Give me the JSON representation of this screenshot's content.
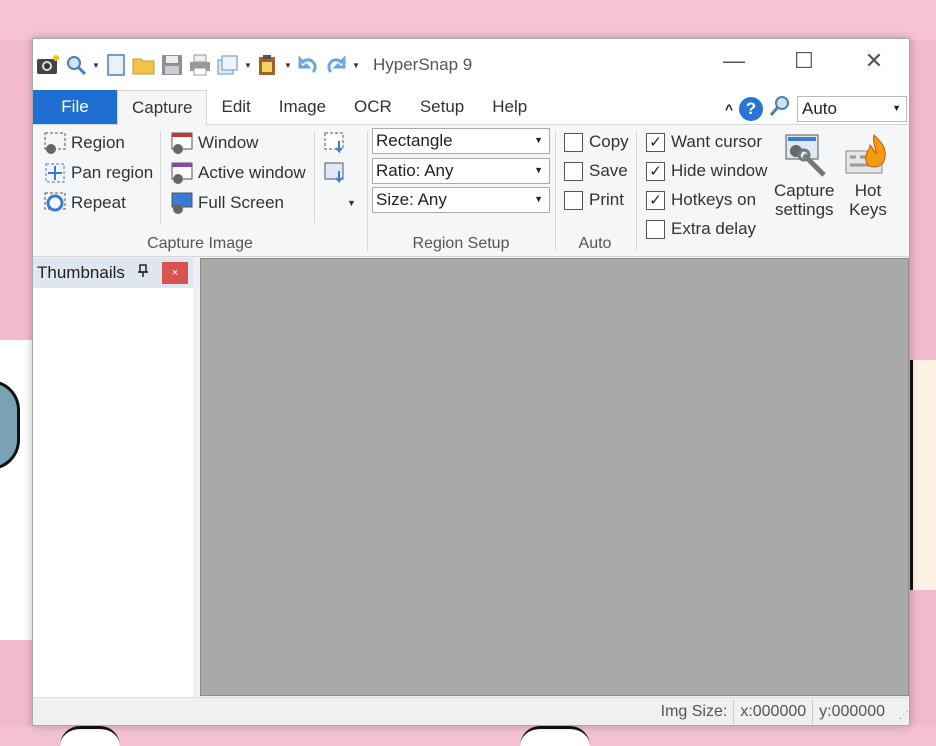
{
  "window": {
    "title": "HyperSnap 9"
  },
  "quick_access": [
    "camera-icon",
    "zoom-icon",
    "new-icon",
    "open-icon",
    "save-icon",
    "print-icon",
    "copy-icon",
    "paste-icon",
    "undo-icon",
    "redo-icon"
  ],
  "tabs": [
    {
      "label": "File"
    },
    {
      "label": "Capture"
    },
    {
      "label": "Edit"
    },
    {
      "label": "Image"
    },
    {
      "label": "OCR"
    },
    {
      "label": "Setup"
    },
    {
      "label": "Help"
    }
  ],
  "zoom": {
    "value": "Auto"
  },
  "capture_image": {
    "label": "Capture Image",
    "region": "Region",
    "pan_region": "Pan region",
    "repeat": "Repeat",
    "window": "Window",
    "active_window": "Active window",
    "full_screen": "Full Screen"
  },
  "region_setup": {
    "label": "Region Setup",
    "shape": "Rectangle",
    "ratio": "Ratio: Any",
    "size": "Size: Any"
  },
  "auto": {
    "label": "Auto",
    "copy": "Copy",
    "save": "Save",
    "print": "Print"
  },
  "options": {
    "want_cursor": "Want cursor",
    "hide_window": "Hide window",
    "hotkeys_on": "Hotkeys on",
    "extra_delay": "Extra delay"
  },
  "big_buttons": {
    "capture_settings_l1": "Capture",
    "capture_settings_l2": "settings",
    "hot_keys_l1": "Hot",
    "hot_keys_l2": "Keys"
  },
  "thumbnails": {
    "title": "Thumbnails",
    "close": "×"
  },
  "status": {
    "img_size": "Img Size:",
    "x": "x:000000",
    "y": "y:000000"
  },
  "colors": {
    "file_tab": "#1e6fd1",
    "canvas": "#a9a9a9"
  }
}
